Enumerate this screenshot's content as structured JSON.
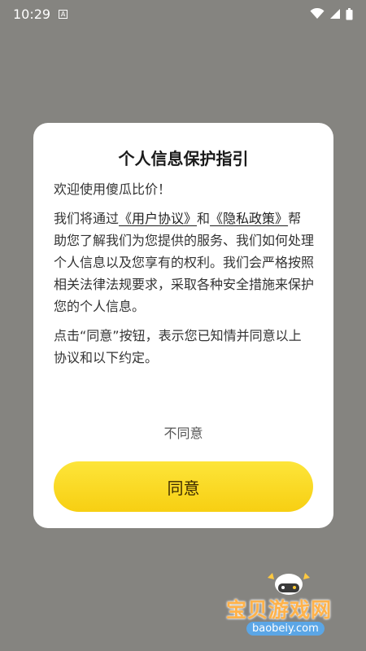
{
  "status_bar": {
    "time": "10:29",
    "notification_glyph": "A",
    "icons": [
      "wifi-icon",
      "signal-icon",
      "battery-icon"
    ]
  },
  "dialog": {
    "title": "个人信息保护指引",
    "welcome": "欢迎使用傻瓜比价！",
    "para1_prefix": "我们将通过",
    "user_agreement_link": "《用户协议》",
    "para1_and": "和",
    "privacy_policy_link": "《隐私政策》",
    "para1_suffix": "帮助您了解我们为您提供的服务、我们如何处理个人信息以及您享有的权利。我们会严格按照相关法律法规要求，采取各种安全措施来保护您的个人信息。",
    "para2": "点击“同意”按钮，表示您已知情并同意以上协议和以下约定。",
    "decline_label": "不同意",
    "agree_label": "同意"
  },
  "watermark": {
    "text": "宝贝游戏网",
    "url": "baobeiy.com"
  },
  "colors": {
    "overlay": "#858480",
    "agree_button": "#fcdc2a",
    "watermark_text": "#ffb24a",
    "watermark_url_bg": "#5ba6e6"
  }
}
